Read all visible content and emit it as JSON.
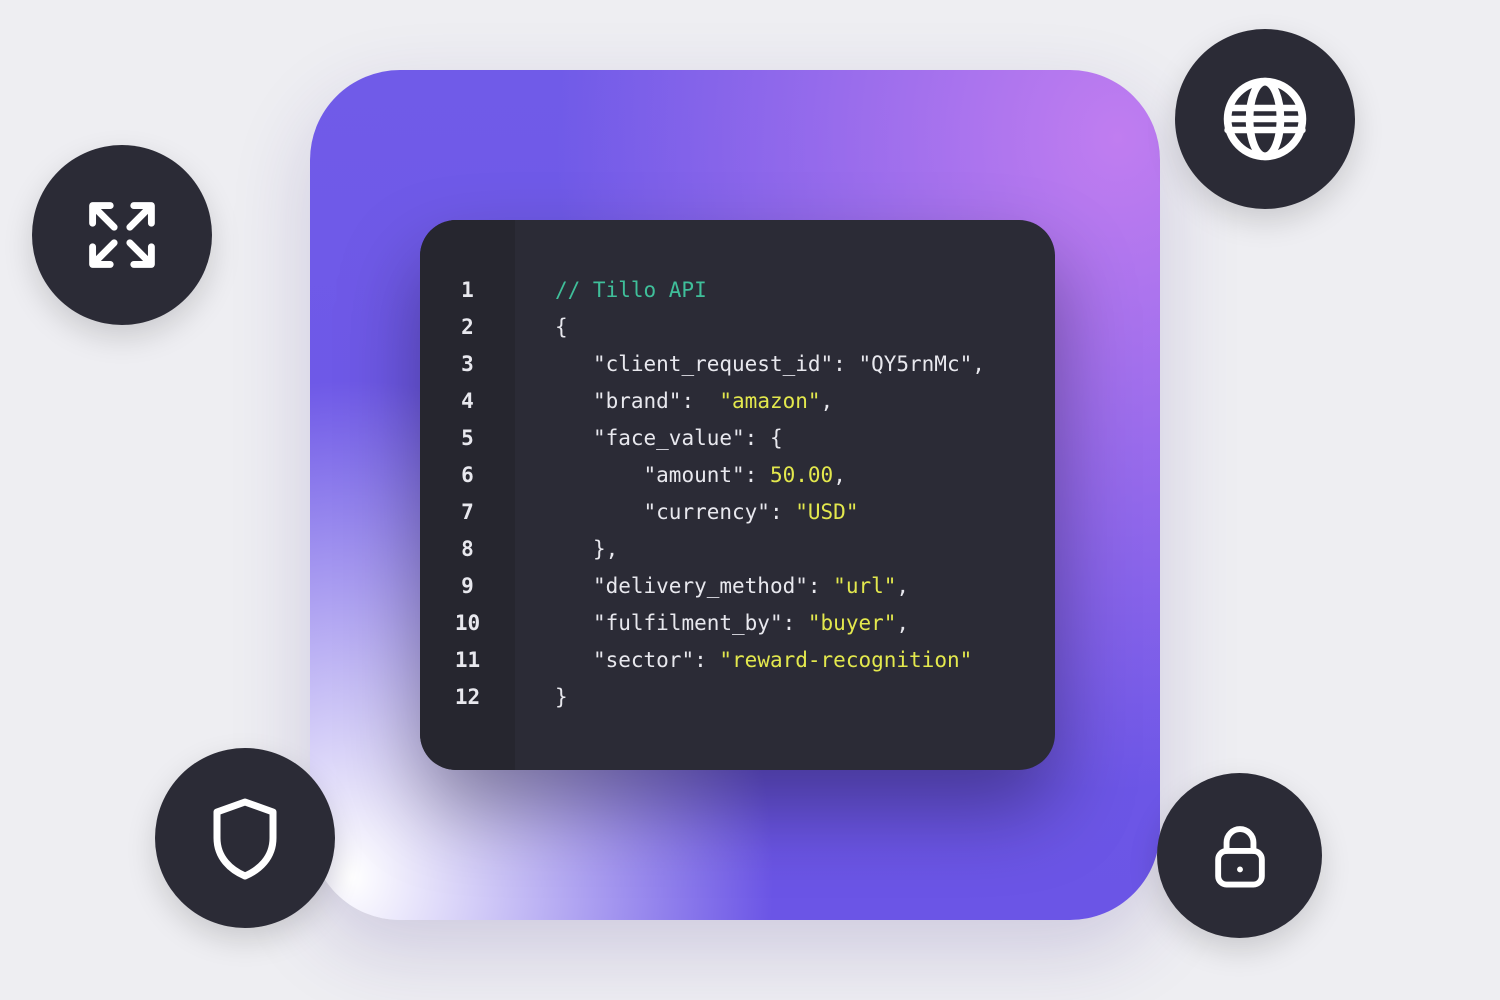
{
  "code": {
    "comment": "// Tillo API",
    "line_numbers": [
      "1",
      "2",
      "3",
      "4",
      "5",
      "6",
      "7",
      "8",
      "9",
      "10",
      "11",
      "12"
    ],
    "obj": {
      "client_request_id": {
        "key": "\"client_request_id\"",
        "value": "\"QY5rnMc\""
      },
      "brand": {
        "key": "\"brand\"",
        "value": "\"amazon\""
      },
      "face_value_key": "\"face_value\"",
      "amount": {
        "key": "\"amount\"",
        "value": "50.00"
      },
      "currency": {
        "key": "\"currency\"",
        "value": "\"USD\""
      },
      "delivery_method": {
        "key": "\"delivery_method\"",
        "value": "\"url\""
      },
      "fulfilment_by": {
        "key": "\"fulfilment_by\"",
        "value": "\"buyer\""
      },
      "sector": {
        "key": "\"sector\"",
        "value": "\"reward-recognition\""
      }
    }
  },
  "icons": {
    "expand": "expand-icon",
    "globe": "globe-icon",
    "shield": "shield-icon",
    "lock": "lock-icon"
  }
}
